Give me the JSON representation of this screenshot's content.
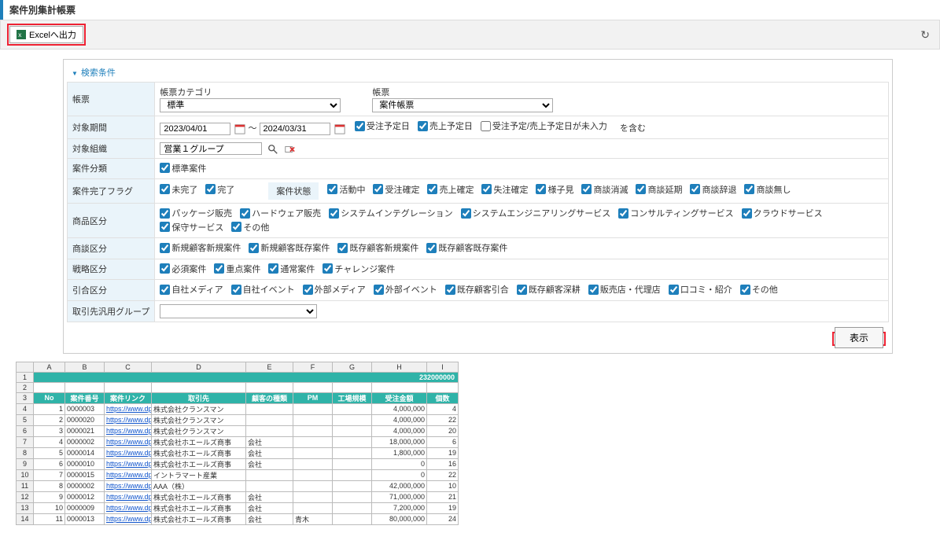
{
  "page_title": "案件別集計帳票",
  "toolbar": {
    "excel_label": "Excelへ出力"
  },
  "search": {
    "header": "検索条件",
    "rows": {
      "report": {
        "label": "帳票",
        "cat_label": "帳票カテゴリ",
        "cat_value": "標準",
        "rep_label": "帳票",
        "rep_value": "案件帳票"
      },
      "period": {
        "label": "対象期間",
        "from": "2023/04/01",
        "sep": "～",
        "to": "2024/03/31",
        "cb": [
          {
            "label": "受注予定日",
            "checked": true
          },
          {
            "label": "売上予定日",
            "checked": true
          },
          {
            "label": "受注予定/売上予定日が未入力",
            "checked": false
          }
        ],
        "suffix": "を含む"
      },
      "org": {
        "label": "対象組織",
        "value": "営業１グループ"
      },
      "type": {
        "label": "案件分類",
        "cb": [
          {
            "label": "標準案件",
            "checked": true
          }
        ]
      },
      "complete": {
        "label": "案件完了フラグ",
        "cb": [
          {
            "label": "未完了",
            "checked": true
          },
          {
            "label": "完了",
            "checked": true
          }
        ],
        "status_label": "案件状態",
        "status_cb": [
          {
            "label": "活動中",
            "checked": true
          },
          {
            "label": "受注確定",
            "checked": true
          },
          {
            "label": "売上確定",
            "checked": true
          },
          {
            "label": "失注確定",
            "checked": true
          },
          {
            "label": "様子見",
            "checked": true
          },
          {
            "label": "商談消滅",
            "checked": true
          },
          {
            "label": "商談延期",
            "checked": true
          },
          {
            "label": "商談辞退",
            "checked": true
          },
          {
            "label": "商談無し",
            "checked": true
          }
        ]
      },
      "product": {
        "label": "商品区分",
        "cb": [
          {
            "label": "パッケージ販売",
            "checked": true
          },
          {
            "label": "ハードウェア販売",
            "checked": true
          },
          {
            "label": "システムインテグレーション",
            "checked": true
          },
          {
            "label": "システムエンジニアリングサービス",
            "checked": true
          },
          {
            "label": "コンサルティングサービス",
            "checked": true
          },
          {
            "label": "クラウドサービス",
            "checked": true
          },
          {
            "label": "保守サービス",
            "checked": true
          },
          {
            "label": "その他",
            "checked": true
          }
        ]
      },
      "negotiation": {
        "label": "商談区分",
        "cb": [
          {
            "label": "新規顧客新規案件",
            "checked": true
          },
          {
            "label": "新規顧客既存案件",
            "checked": true
          },
          {
            "label": "既存顧客新規案件",
            "checked": true
          },
          {
            "label": "既存顧客既存案件",
            "checked": true
          }
        ]
      },
      "strategy": {
        "label": "戦略区分",
        "cb": [
          {
            "label": "必須案件",
            "checked": true
          },
          {
            "label": "重点案件",
            "checked": true
          },
          {
            "label": "通常案件",
            "checked": true
          },
          {
            "label": "チャレンジ案件",
            "checked": true
          }
        ]
      },
      "inquiry": {
        "label": "引合区分",
        "cb": [
          {
            "label": "自社メディア",
            "checked": true
          },
          {
            "label": "自社イベント",
            "checked": true
          },
          {
            "label": "外部メディア",
            "checked": true
          },
          {
            "label": "外部イベント",
            "checked": true
          },
          {
            "label": "既存顧客引合",
            "checked": true
          },
          {
            "label": "既存顧客深耕",
            "checked": true
          },
          {
            "label": "販売店・代理店",
            "checked": true
          },
          {
            "label": "口コミ・紹介",
            "checked": true
          },
          {
            "label": "その他",
            "checked": true
          }
        ]
      },
      "partner_group": {
        "label": "取引先汎用グループ"
      }
    },
    "display_btn": "表示"
  },
  "spreadsheet": {
    "col_letters": [
      "A",
      "B",
      "C",
      "D",
      "E",
      "F",
      "G",
      "H",
      "I"
    ],
    "total_value": "232000000",
    "headers": [
      "No",
      "案件番号",
      "案件リンク",
      "取引先",
      "顧客の種類",
      "PM",
      "工場規模",
      "受注金額",
      "個数"
    ],
    "rows": [
      {
        "n": 4,
        "no": 1,
        "id": "0000003",
        "link": "https://www.dp",
        "partner": "株式会社クランスマン",
        "cust": "",
        "pm": "",
        "scale": "",
        "amt": "4,000,000",
        "qty": 4
      },
      {
        "n": 5,
        "no": 2,
        "id": "0000020",
        "link": "https://www.dp",
        "partner": "株式会社クランスマン",
        "cust": "",
        "pm": "",
        "scale": "",
        "amt": "4,000,000",
        "qty": 22
      },
      {
        "n": 6,
        "no": 3,
        "id": "0000021",
        "link": "https://www.dp",
        "partner": "株式会社クランスマン",
        "cust": "",
        "pm": "",
        "scale": "",
        "amt": "4,000,000",
        "qty": 20
      },
      {
        "n": 7,
        "no": 4,
        "id": "0000002",
        "link": "https://www.dp",
        "partner": "株式会社ホエールズ商事",
        "cust": "会社",
        "pm": "",
        "scale": "",
        "amt": "18,000,000",
        "qty": 6
      },
      {
        "n": 8,
        "no": 5,
        "id": "0000014",
        "link": "https://www.dp",
        "partner": "株式会社ホエールズ商事",
        "cust": "会社",
        "pm": "",
        "scale": "",
        "amt": "1,800,000",
        "qty": 19
      },
      {
        "n": 9,
        "no": 6,
        "id": "0000010",
        "link": "https://www.dp",
        "partner": "株式会社ホエールズ商事",
        "cust": "会社",
        "pm": "",
        "scale": "",
        "amt": "0",
        "qty": 16
      },
      {
        "n": 10,
        "no": 7,
        "id": "0000015",
        "link": "https://www.dp",
        "partner": "イントラマート産業",
        "cust": "",
        "pm": "",
        "scale": "",
        "amt": "0",
        "qty": 22
      },
      {
        "n": 11,
        "no": 8,
        "id": "0000002",
        "link": "https://www.dp",
        "partner": "AAA（株）",
        "cust": "",
        "pm": "",
        "scale": "",
        "amt": "42,000,000",
        "qty": 10
      },
      {
        "n": 12,
        "no": 9,
        "id": "0000012",
        "link": "https://www.dp",
        "partner": "株式会社ホエールズ商事",
        "cust": "会社",
        "pm": "",
        "scale": "",
        "amt": "71,000,000",
        "qty": 21
      },
      {
        "n": 13,
        "no": 10,
        "id": "0000009",
        "link": "https://www.dp",
        "partner": "株式会社ホエールズ商事",
        "cust": "会社",
        "pm": "",
        "scale": "",
        "amt": "7,200,000",
        "qty": 19
      },
      {
        "n": 14,
        "no": 11,
        "id": "0000013",
        "link": "https://www.dp",
        "partner": "株式会社ホエールズ商事",
        "cust": "会社",
        "pm": "青木",
        "scale": "",
        "amt": "80,000,000",
        "qty": 24
      }
    ]
  }
}
